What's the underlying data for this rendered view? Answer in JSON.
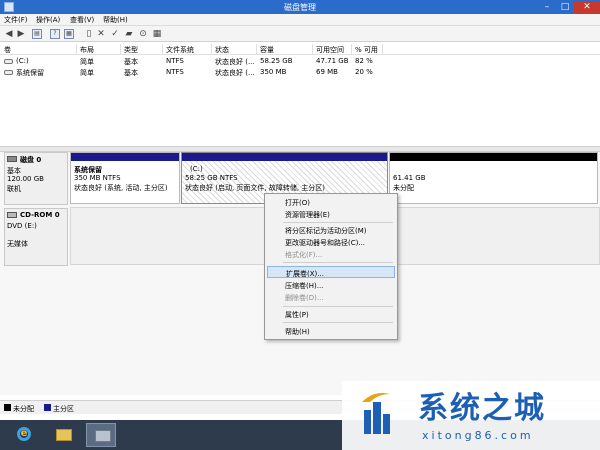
{
  "window": {
    "title": "磁盘管理"
  },
  "menu": [
    "文件(F)",
    "操作(A)",
    "查看(V)",
    "帮助(H)"
  ],
  "volume_table": {
    "columns": [
      "卷",
      "布局",
      "类型",
      "文件系统",
      "状态",
      "容量",
      "可用空间",
      "% 可用"
    ],
    "rows": [
      {
        "volume": "(C:)",
        "layout": "简单",
        "type": "基本",
        "fs": "NTFS",
        "status": "状态良好 (...",
        "capacity": "58.25 GB",
        "free": "47.71 GB",
        "pct": "82 %"
      },
      {
        "volume": "系统保留",
        "layout": "简单",
        "type": "基本",
        "fs": "NTFS",
        "status": "状态良好 (...",
        "capacity": "350 MB",
        "free": "69 MB",
        "pct": "20 %"
      }
    ]
  },
  "disk0": {
    "name": "磁盘 0",
    "type": "基本",
    "size": "120.00 GB",
    "state": "联机",
    "partitions": [
      {
        "name": "系统保留",
        "size": "350 MB NTFS",
        "status": "状态良好 (系统, 活动, 主分区)"
      },
      {
        "name": "(C:)",
        "size": "58.25 GB NTFS",
        "status": "状态良好 (启动, 页面文件, 故障转储, 主分区)"
      },
      {
        "name": "",
        "size": "61.41 GB",
        "status": "未分配"
      }
    ]
  },
  "cdrom": {
    "name": "CD-ROM 0",
    "drive": "DVD (E:)",
    "state": "无媒体"
  },
  "context_menu": {
    "open": "打开(O)",
    "explore": "资源管理器(E)",
    "mark_active": "将分区标记为活动分区(M)",
    "change_letter": "更改驱动器号和路径(C)...",
    "format": "格式化(F)...",
    "extend": "扩展卷(X)...",
    "shrink": "压缩卷(H)...",
    "delete": "删除卷(D)...",
    "properties": "属性(P)",
    "help": "帮助(H)"
  },
  "legend": {
    "unallocated": "未分配",
    "primary": "主分区"
  },
  "watermark": {
    "brand": "系统之城",
    "url": "xitong86.com"
  },
  "colors": {
    "titlebar": "#2b6bc9",
    "partition_bar": "#1a1a8c",
    "unallocated_bar": "#000000",
    "highlight": "#d5e6f7",
    "brand": "#1d5fb4"
  }
}
